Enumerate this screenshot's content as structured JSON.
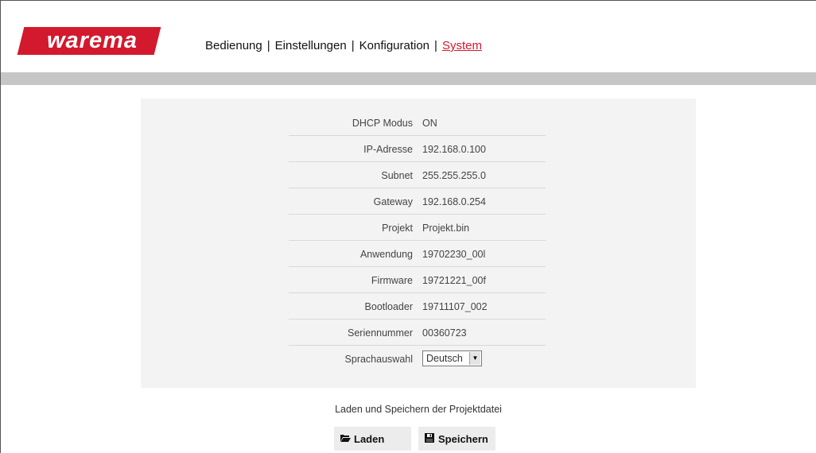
{
  "header": {
    "logo_text": "warema",
    "nav": {
      "items": [
        "Bedienung",
        "Einstellungen",
        "Konfiguration",
        "System"
      ],
      "separator": "|",
      "active": "System"
    }
  },
  "colors": {
    "brand_red": "#d3192d",
    "panel_bg": "#f3f3f3",
    "bar_grey": "#c6c6c6"
  },
  "system_info": {
    "rows": [
      {
        "label": "DHCP Modus",
        "value": "ON"
      },
      {
        "label": "IP-Adresse",
        "value": "192.168.0.100"
      },
      {
        "label": "Subnet",
        "value": "255.255.255.0"
      },
      {
        "label": "Gateway",
        "value": "192.168.0.254"
      },
      {
        "label": "Projekt",
        "value": "Projekt.bin"
      },
      {
        "label": "Anwendung",
        "value": "19702230_00l"
      },
      {
        "label": "Firmware",
        "value": "19721221_00f"
      },
      {
        "label": "Bootloader",
        "value": "19711107_002"
      },
      {
        "label": "Seriennummer",
        "value": "00360723"
      }
    ],
    "language": {
      "label": "Sprachauswahl",
      "selected": "Deutsch"
    }
  },
  "project_file": {
    "caption": "Laden und Speichern der Projektdatei",
    "load_label": "Laden",
    "save_label": "Speichern",
    "load_icon": "folder-open-icon",
    "save_icon": "floppy-disk-icon"
  }
}
